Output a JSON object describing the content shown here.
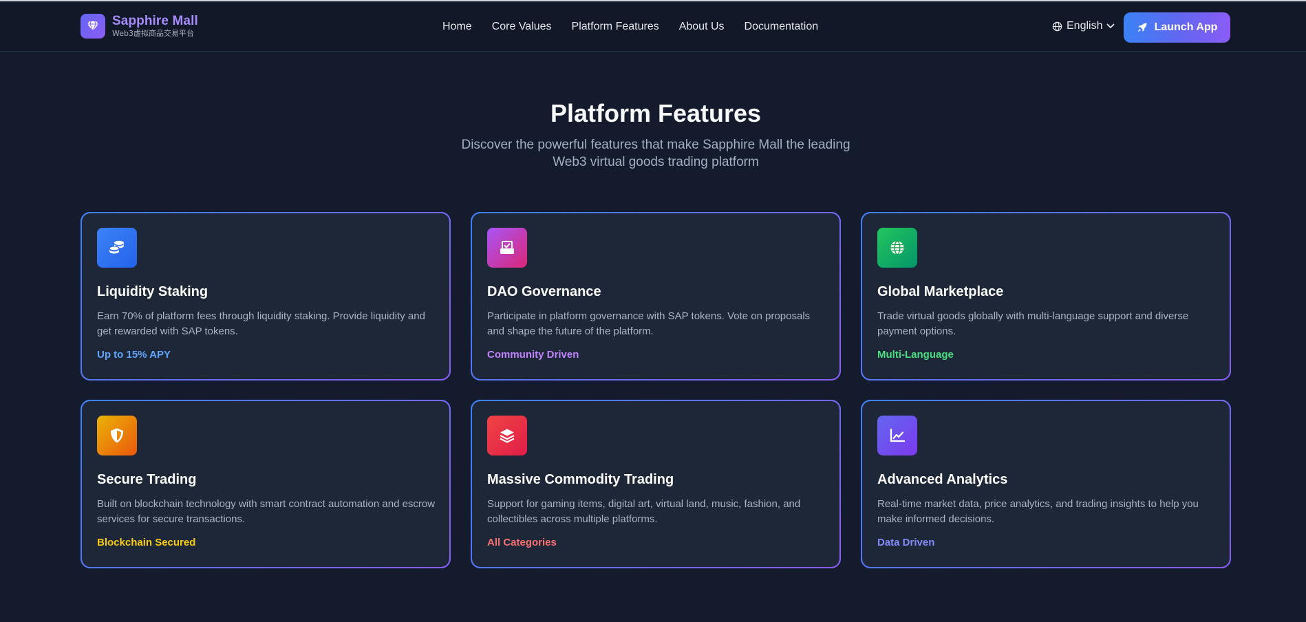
{
  "header": {
    "brand_name": "Sapphire Mall",
    "brand_sub": "Web3虚拟商品交易平台",
    "nav": [
      "Home",
      "Core Values",
      "Platform Features",
      "About Us",
      "Documentation"
    ],
    "language": "English",
    "launch_label": "Launch App"
  },
  "section": {
    "title": "Platform Features",
    "subtitle": "Discover the powerful features that make Sapphire Mall the leading Web3 virtual goods trading platform"
  },
  "cards": [
    {
      "title": "Liquidity Staking",
      "desc": "Earn 70% of platform fees through liquidity staking. Provide liquidity and get rewarded with SAP tokens.",
      "tag": "Up to 15% APY",
      "tag_color": "#60a5fa",
      "icon": "coins-icon",
      "icon_colors": [
        "#3b82f6",
        "#2563eb"
      ]
    },
    {
      "title": "DAO Governance",
      "desc": "Participate in platform governance with SAP tokens. Vote on proposals and shape the future of the platform.",
      "tag": "Community Driven",
      "tag_color": "#c084fc",
      "icon": "vote-box-icon",
      "icon_colors": [
        "#a855f7",
        "#db2777"
      ]
    },
    {
      "title": "Global Marketplace",
      "desc": "Trade virtual goods globally with multi-language support and diverse payment options.",
      "tag": "Multi-Language",
      "tag_color": "#4ade80",
      "icon": "globe-icon",
      "icon_colors": [
        "#22c55e",
        "#059669"
      ]
    },
    {
      "title": "Secure Trading",
      "desc": "Built on blockchain technology with smart contract automation and escrow services for secure transactions.",
      "tag": "Blockchain Secured",
      "tag_color": "#facc15",
      "icon": "shield-icon",
      "icon_colors": [
        "#eab308",
        "#ea580c"
      ]
    },
    {
      "title": "Massive Commodity Trading",
      "desc": "Support for gaming items, digital art, virtual land, music, fashion, and collectibles across multiple platforms.",
      "tag": "All Categories",
      "tag_color": "#f87171",
      "icon": "layers-icon",
      "icon_colors": [
        "#ef4444",
        "#e11d48"
      ]
    },
    {
      "title": "Advanced Analytics",
      "desc": "Real-time market data, price analytics, and trading insights to help you make informed decisions.",
      "tag": "Data Driven",
      "tag_color": "#818cf8",
      "icon": "chart-line-icon",
      "icon_colors": [
        "#6366f1",
        "#7c3aed"
      ]
    }
  ]
}
